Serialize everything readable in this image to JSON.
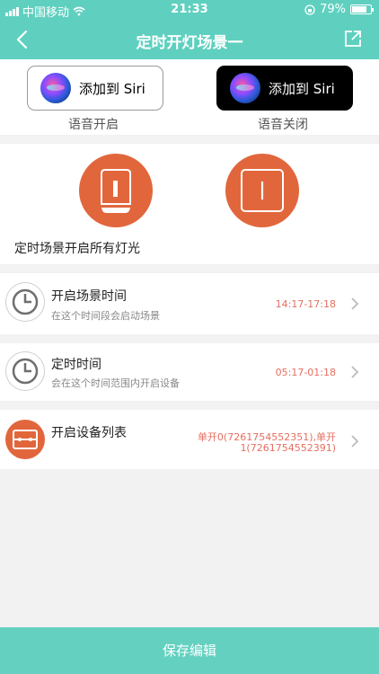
{
  "status_bar": {
    "carrier": "中国移动",
    "time": "21:33",
    "battery": "79%",
    "battery_level": 0.79
  },
  "nav": {
    "title": "定时开灯场景一"
  },
  "siri": {
    "on_button": "添加到 Siri",
    "off_button": "添加到 Siri",
    "on_caption": "语音开启",
    "off_caption": "语音关闭"
  },
  "lights": {
    "caption": "定时场景开启所有灯光"
  },
  "rows": [
    {
      "title": "开启场景时间",
      "subtitle": "在这个时间段会启动场景",
      "value": "14:17-17:18"
    },
    {
      "title": "定时时间",
      "subtitle": "会在这个时间范围内开启设备",
      "value": "05:17-01:18"
    },
    {
      "title": "开启设备列表",
      "value_line1": "单开0(7261754552351),单开",
      "value_line2": "1(7261754552391)"
    }
  ],
  "save_label": "保存编辑",
  "colors": {
    "teal": "#5fd0bf",
    "accent": "#e2663c",
    "value_red": "#e56f60"
  }
}
